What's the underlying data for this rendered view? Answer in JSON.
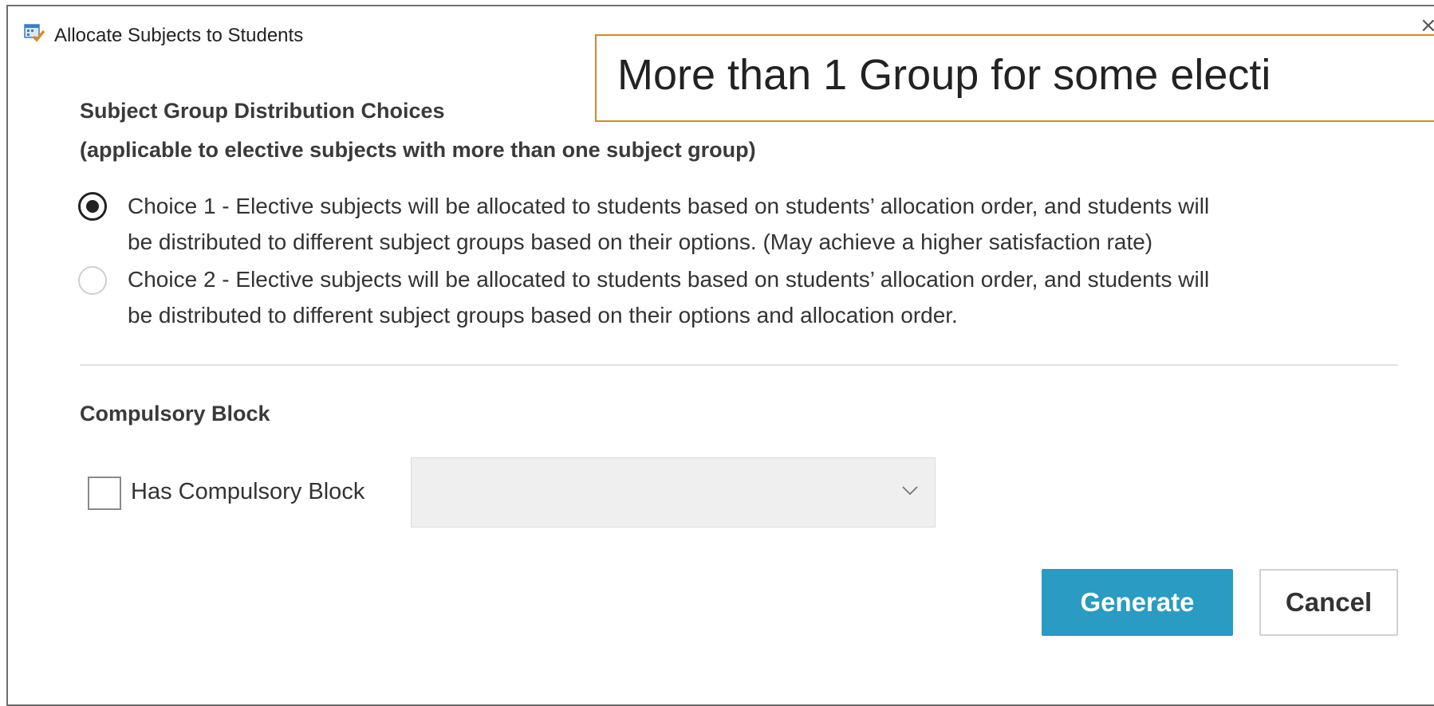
{
  "window": {
    "title": "Allocate Subjects to Students",
    "close_glyph": "×"
  },
  "annotation": {
    "text": "More than 1 Group for some electi"
  },
  "distribution": {
    "heading_line1": "Subject Group Distribution Choices",
    "heading_line2": "(applicable to elective subjects with more than one subject group)",
    "choices": [
      {
        "line1": "Choice 1 - Elective subjects will be allocated to students based on students’ allocation order, and students will",
        "line2": "be distributed to different subject groups based on their options. (May achieve a higher satisfaction rate)",
        "selected": true
      },
      {
        "line1": "Choice 2 - Elective subjects will be allocated to students based on students’ allocation order, and students will",
        "line2": "be distributed to different subject groups based on their options and allocation order.",
        "selected": false
      }
    ]
  },
  "compulsory": {
    "heading": "Compulsory Block",
    "checkbox_label": "Has Compulsory Block",
    "checked": false,
    "select_value": ""
  },
  "buttons": {
    "generate": "Generate",
    "cancel": "Cancel"
  },
  "colors": {
    "primary": "#2a9bc2",
    "annotation_border": "#d28a2c"
  },
  "icons": {
    "app": "calendar-check-icon",
    "close": "close-icon",
    "dropdown": "chevron-down-icon"
  }
}
